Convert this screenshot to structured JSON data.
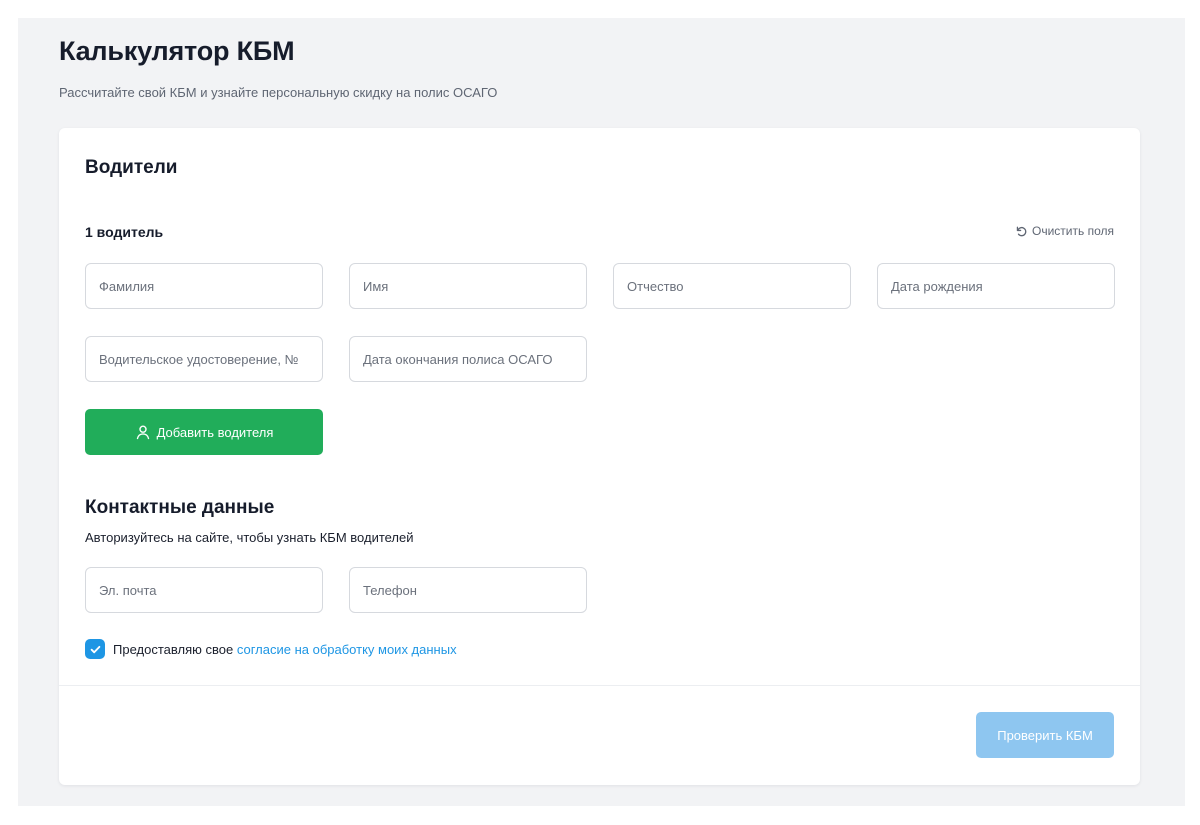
{
  "header": {
    "title": "Калькулятор КБМ",
    "subtitle": "Рассчитайте свой КБМ и узнайте персональную скидку на полис ОСАГО"
  },
  "drivers": {
    "section_title": "Водители",
    "driver_label": "1 водитель",
    "clear_label": "Очистить поля",
    "fields": {
      "last_name": {
        "placeholder": "Фамилия",
        "value": ""
      },
      "first_name": {
        "placeholder": "Имя",
        "value": ""
      },
      "patronymic": {
        "placeholder": "Отчество",
        "value": ""
      },
      "birth_date": {
        "placeholder": "Дата рождения",
        "value": ""
      },
      "license": {
        "placeholder": "Водительское удостоверение, №",
        "value": ""
      },
      "policy_end": {
        "placeholder": "Дата окончания полиса ОСАГО",
        "value": ""
      }
    },
    "add_driver_label": "Добавить водителя"
  },
  "contacts": {
    "section_title": "Контактные данные",
    "description": "Авторизуйтесь на сайте, чтобы узнать КБМ водителей",
    "fields": {
      "email": {
        "placeholder": "Эл. почта",
        "value": ""
      },
      "phone": {
        "placeholder": "Телефон",
        "value": ""
      }
    },
    "consent_text": "Предоставляю свое",
    "consent_link": "согласие на обработку моих данных",
    "consent_checked": true
  },
  "submit_label": "Проверить КБМ",
  "icons": {
    "clear": "refresh-icon",
    "add_driver": "user-icon",
    "checkbox": "check-icon"
  },
  "colors": {
    "accent_green": "#21ad5a",
    "accent_blue": "#1e96e4",
    "submit_disabled": "#8ec6f0"
  }
}
